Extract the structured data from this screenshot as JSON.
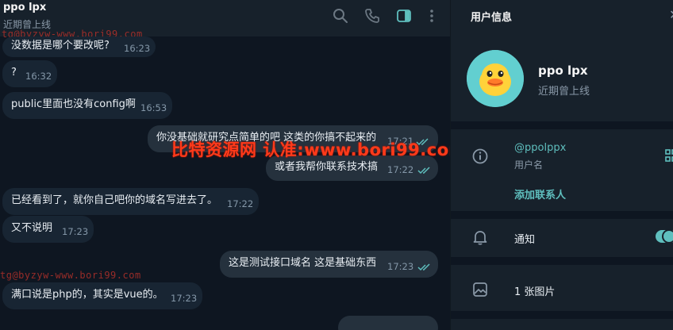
{
  "chat": {
    "title": "ppo lpx",
    "status": "近期曾上线",
    "watermark_small": "tg@byzyw-www.bori99.com",
    "messages": [
      {
        "dir": "in",
        "text": "没数据是哪个要改呢?",
        "time": "16:23"
      },
      {
        "dir": "in",
        "text": "?",
        "time": "16:32"
      },
      {
        "dir": "in",
        "text": "public里面也没有config啊",
        "time": "16:53"
      },
      {
        "dir": "out",
        "text": "你没基础就研究点简单的吧 这类的你搞不起来的",
        "time": "17:21"
      },
      {
        "dir": "out",
        "text": "或者我帮你联系技术搞",
        "time": "17:22"
      },
      {
        "dir": "in",
        "text": "已经看到了，就你自己吧你的域名写进去了。",
        "time": "17:22"
      },
      {
        "dir": "in",
        "text": "又不说明",
        "time": "17:23"
      },
      {
        "dir": "out",
        "text": "这是测试接口域名 这是基础东西",
        "time": "17:23"
      },
      {
        "dir": "in",
        "text": "满口说是php的，其实是vue的。",
        "time": "17:23"
      }
    ],
    "big_watermark": "比特资源网 认准:www.bori99.com",
    "icons": [
      "search-icon",
      "phone-icon",
      "sidebar-toggle-icon",
      "more-icon"
    ]
  },
  "info": {
    "title": "用户信息",
    "name": "ppo lpx",
    "status": "近期曾上线",
    "username": "@ppolppx",
    "username_label": "用户名",
    "add_contact": "添加联系人",
    "notifications_label": "通知",
    "notifications_on": true,
    "photos": "1 张图片"
  },
  "colors": {
    "accent": "#5fbfbe",
    "chat_bg": "#0e1621",
    "panel_bg": "#17212b",
    "bubble_in": "#182533",
    "watermark": "#ff3a1a"
  }
}
